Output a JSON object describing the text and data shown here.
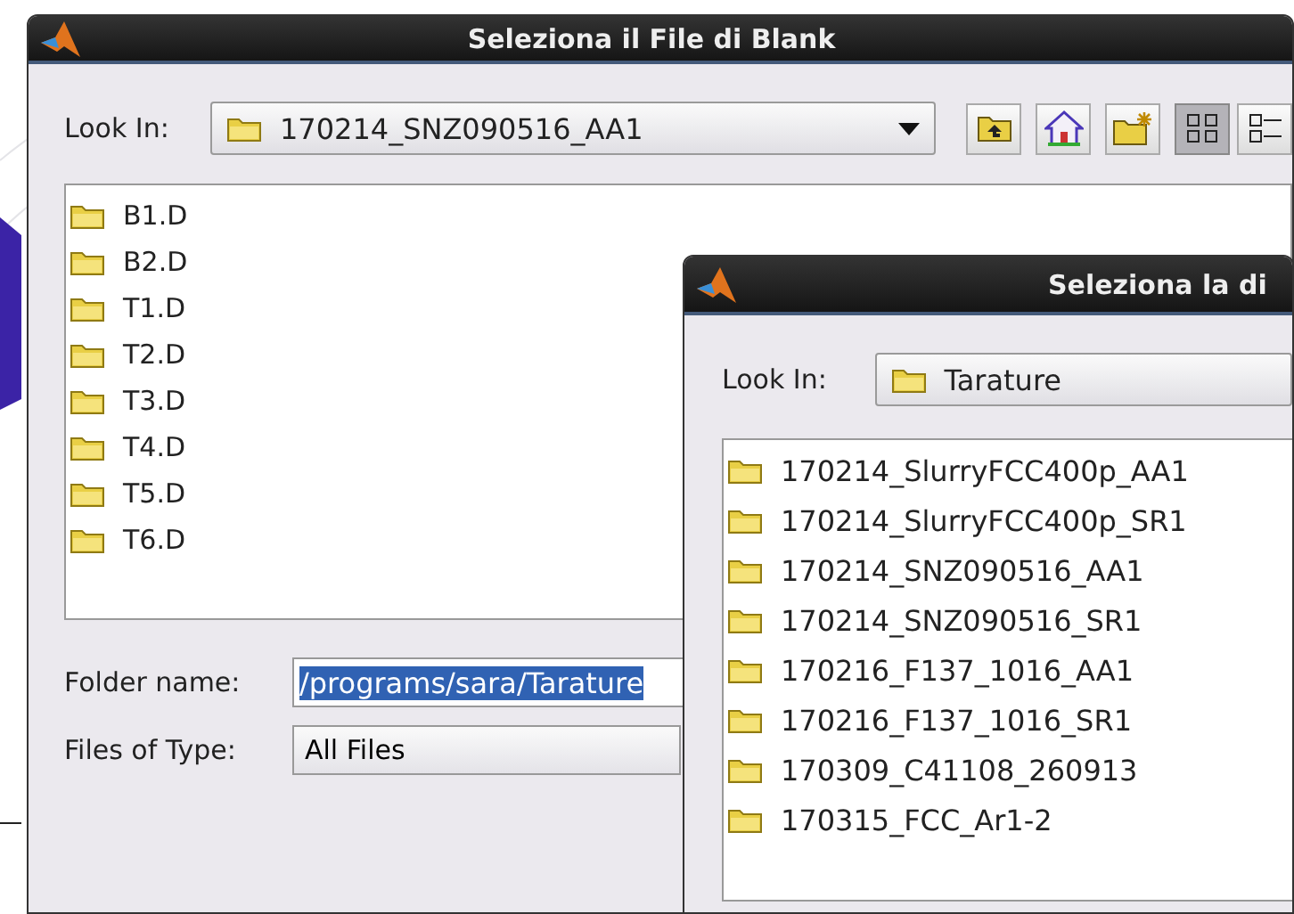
{
  "dialogs": [
    {
      "title": "Seleziona il File di Blank",
      "look_in": {
        "label": "Look In:",
        "value": "170214_SNZ090516_AA1"
      },
      "toolbar": [
        {
          "kind": "up"
        },
        {
          "kind": "home"
        },
        {
          "kind": "new-folder"
        },
        {
          "kind": "list",
          "selected": true
        },
        {
          "kind": "details",
          "selected": false
        }
      ],
      "files": [
        "B1.D",
        "B2.D",
        "T1.D",
        "T2.D",
        "T3.D",
        "T4.D",
        "T5.D",
        "T6.D"
      ],
      "folder_name": {
        "label": "Folder name:",
        "value": "/programs/sara/Tarature",
        "selected": true
      },
      "file_type": {
        "label": "Files of Type:",
        "value": "All Files"
      }
    },
    {
      "title": "Seleziona la di",
      "look_in": {
        "label": "Look In:",
        "value": "Tarature"
      },
      "files": [
        "170214_SlurryFCC400p_AA1",
        "170214_SlurryFCC400p_SR1",
        "170214_SNZ090516_AA1",
        "170214_SNZ090516_SR1",
        "170216_F137_1016_AA1",
        "170216_F137_1016_SR1",
        "170309_C41108_260913",
        "170315_FCC_Ar1-2"
      ]
    }
  ]
}
